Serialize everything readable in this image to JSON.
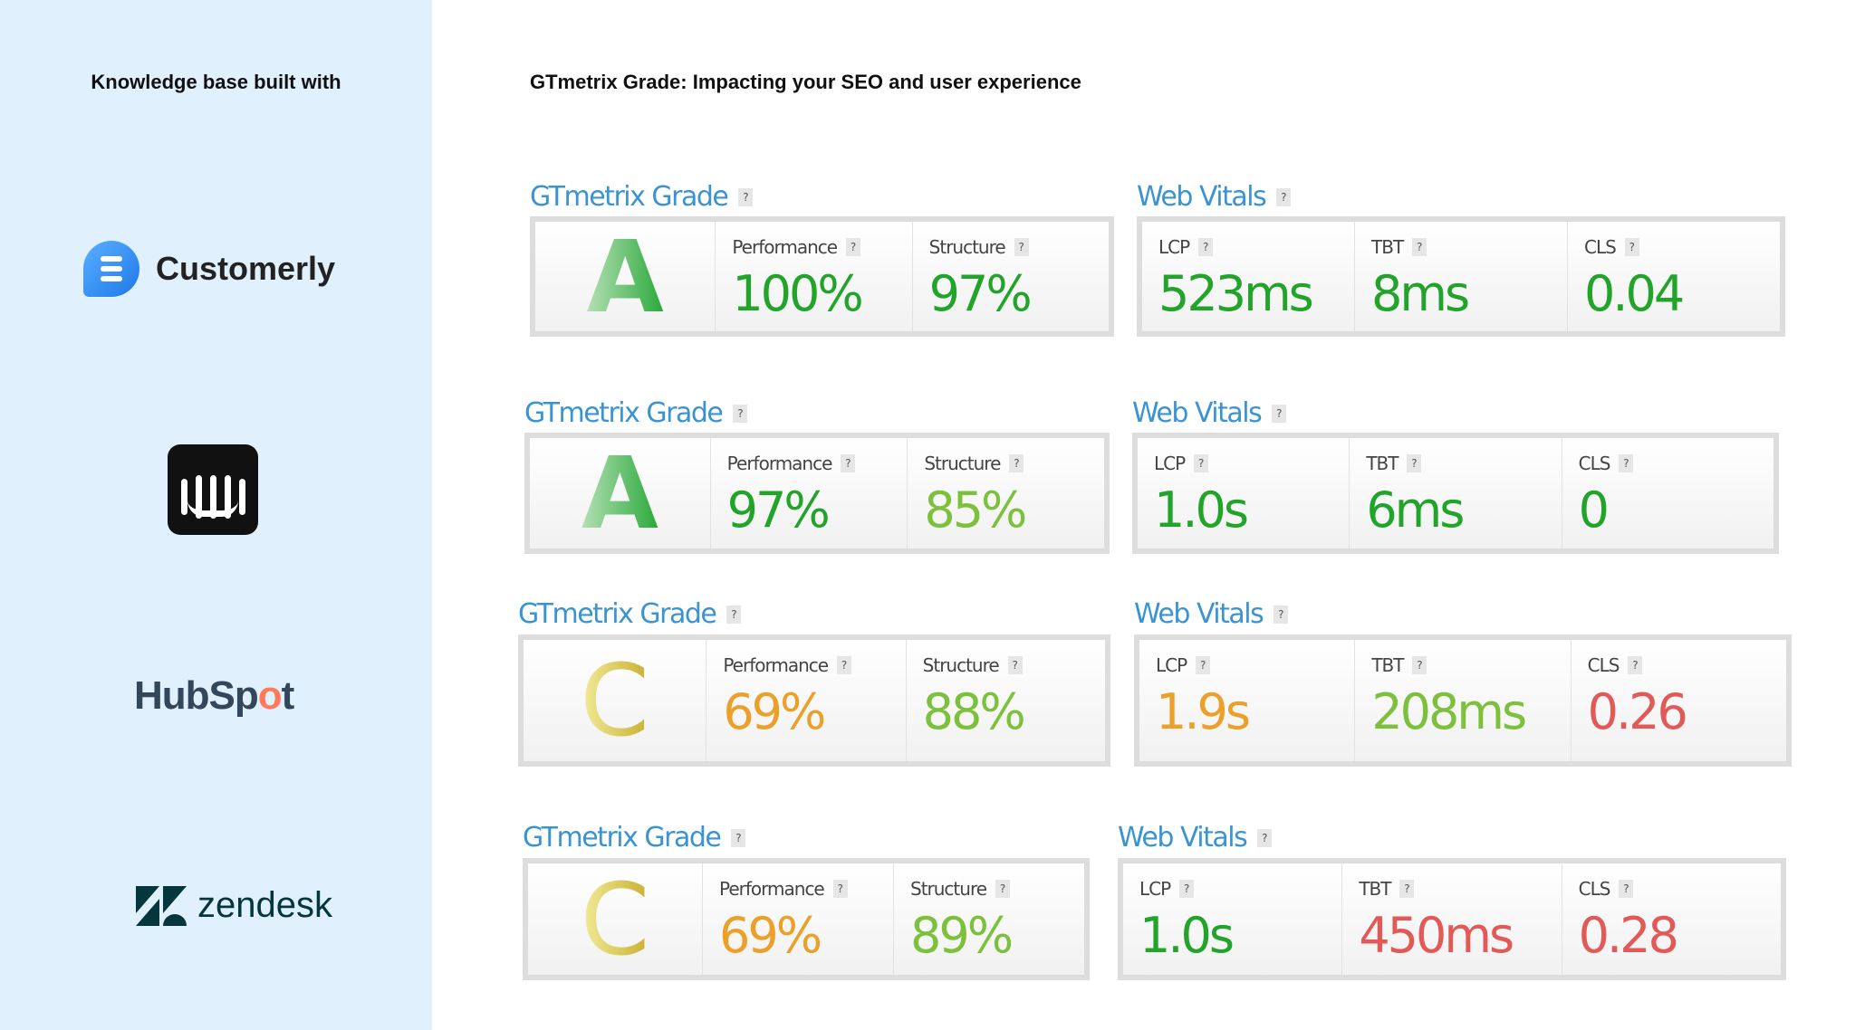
{
  "sidebar": {
    "title": "Knowledge base built with",
    "logos": [
      "Customerly",
      "Intercom",
      "HubSpot",
      "zendesk"
    ]
  },
  "main": {
    "title": "GTmetrix Grade: Impacting your SEO and user experience"
  },
  "colors": {
    "green": "#22a42a",
    "lightgreen": "#7cc03c",
    "orange": "#eba02a",
    "red": "#e25a58",
    "blue": "#3a93d2"
  },
  "rows": [
    {
      "grade_header": "GTmetrix Grade",
      "vitals_header": "Web Vitals",
      "grade": "A",
      "metrics": [
        {
          "label": "Performance",
          "value": "100%",
          "color": "green"
        },
        {
          "label": "Structure",
          "value": "97%",
          "color": "green"
        }
      ],
      "vitals": [
        {
          "label": "LCP",
          "value": "523ms",
          "color": "green"
        },
        {
          "label": "TBT",
          "value": "8ms",
          "color": "green"
        },
        {
          "label": "CLS",
          "value": "0.04",
          "color": "green"
        }
      ]
    },
    {
      "grade_header": "GTmetrix Grade",
      "vitals_header": "Web Vitals",
      "grade": "A",
      "metrics": [
        {
          "label": "Performance",
          "value": "97%",
          "color": "green"
        },
        {
          "label": "Structure",
          "value": "85%",
          "color": "lightgreen"
        }
      ],
      "vitals": [
        {
          "label": "LCP",
          "value": "1.0s",
          "color": "green"
        },
        {
          "label": "TBT",
          "value": "6ms",
          "color": "green"
        },
        {
          "label": "CLS",
          "value": "0",
          "color": "green"
        }
      ]
    },
    {
      "grade_header": "GTmetrix Grade",
      "vitals_header": "Web Vitals",
      "grade": "C",
      "metrics": [
        {
          "label": "Performance",
          "value": "69%",
          "color": "orange"
        },
        {
          "label": "Structure",
          "value": "88%",
          "color": "lightgreen"
        }
      ],
      "vitals": [
        {
          "label": "LCP",
          "value": "1.9s",
          "color": "orange"
        },
        {
          "label": "TBT",
          "value": "208ms",
          "color": "lightgreen"
        },
        {
          "label": "CLS",
          "value": "0.26",
          "color": "red"
        }
      ]
    },
    {
      "grade_header": "GTmetrix Grade",
      "vitals_header": "Web Vitals",
      "grade": "C",
      "metrics": [
        {
          "label": "Performance",
          "value": "69%",
          "color": "orange"
        },
        {
          "label": "Structure",
          "value": "89%",
          "color": "lightgreen"
        }
      ],
      "vitals": [
        {
          "label": "LCP",
          "value": "1.0s",
          "color": "green"
        },
        {
          "label": "TBT",
          "value": "450ms",
          "color": "red"
        },
        {
          "label": "CLS",
          "value": "0.28",
          "color": "red"
        }
      ]
    }
  ],
  "help_icon": "?"
}
